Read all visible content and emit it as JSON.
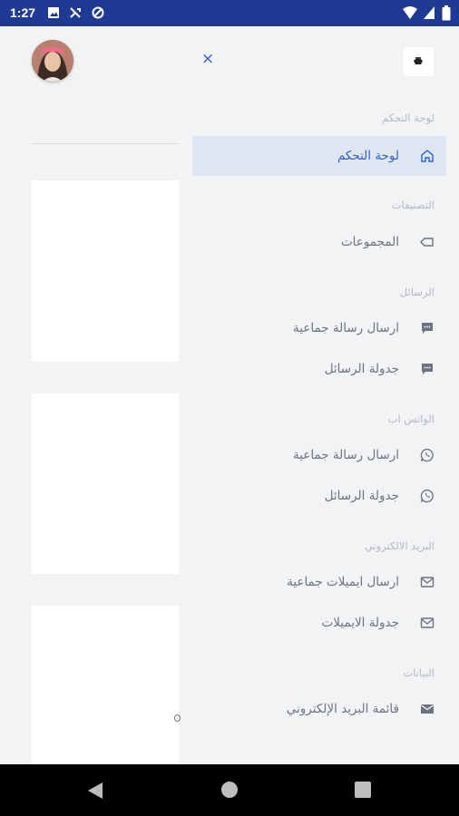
{
  "status_bar": {
    "time": "1:27"
  },
  "drawer": {
    "close_label": "×",
    "sections": {
      "dashboard": "لوحة التحكم",
      "categories": "التصنيفات",
      "messages": "الرسائل",
      "whatsapp": "الواتس اب",
      "email": "البريد الالكتروني",
      "data": "البيانات"
    },
    "items": {
      "dashboard": "لوحة التحكم",
      "groups": "المجموعات",
      "msg_bulk": "ارسال رسالة جماعية",
      "msg_schedule": "جدولة الرسائل",
      "wa_bulk": "ارسال رسالة جماعية",
      "wa_schedule": "جدولة الرسائل",
      "email_bulk": "ارسال ايميلات جماعية",
      "email_schedule": "جدولة الايميلات",
      "email_list": "قائمة البريد الإلكتروني"
    },
    "active_item": "dashboard"
  },
  "colors": {
    "status_bar": "#1f3a93",
    "accent": "#2f5fd0",
    "active_bg": "#dee6f4",
    "section_text": "#b5b9c0",
    "item_text": "#6b7280"
  },
  "icons": {
    "dashboard": "home-icon",
    "groups": "tag-icon",
    "messages": "chat-bubble-icon",
    "whatsapp": "whatsapp-icon",
    "email": "envelope-icon"
  }
}
